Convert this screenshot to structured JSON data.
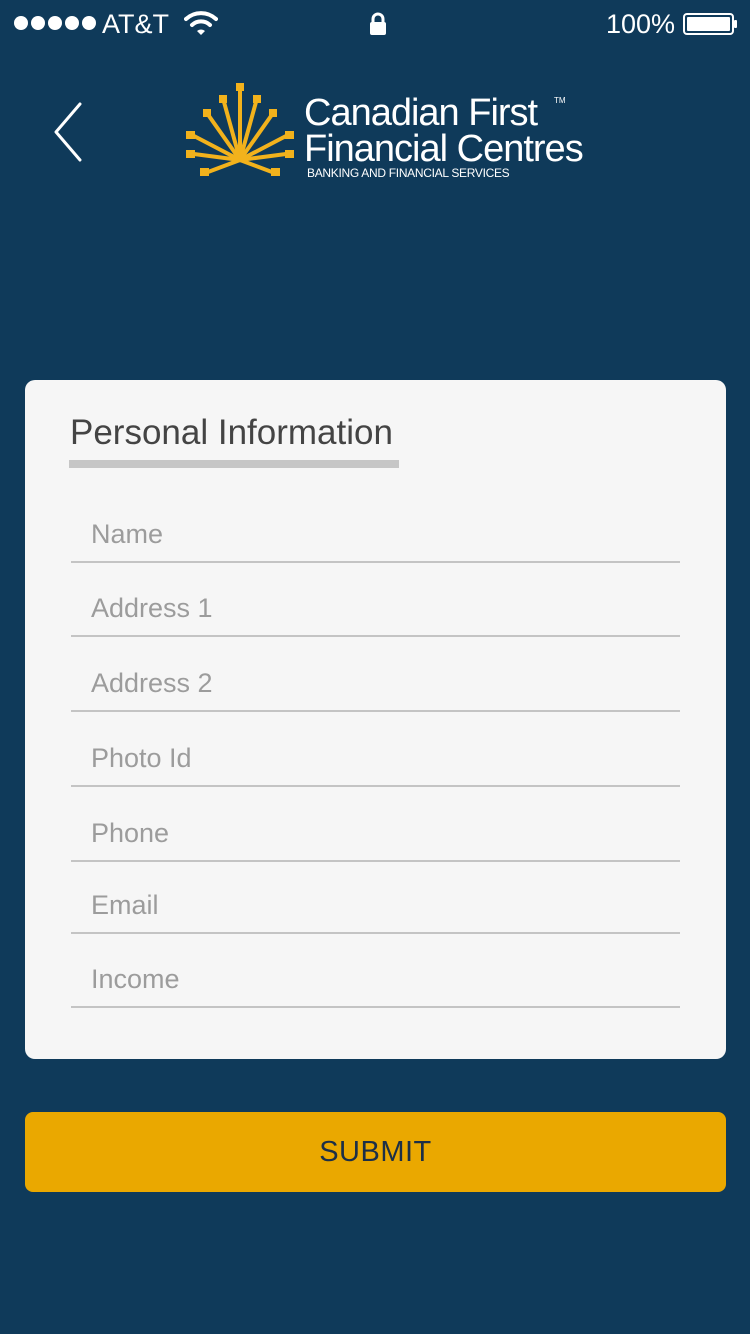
{
  "status_bar": {
    "carrier": "AT&T",
    "battery": "100%",
    "icons": [
      "signal-dots",
      "wifi-icon",
      "lock-icon",
      "battery-icon"
    ]
  },
  "header": {
    "back_icon": "chevron-left-icon",
    "logo": {
      "line1": "Canadian First",
      "line2": "Financial Centres",
      "tm": "TM",
      "tagline": "BANKING AND FINANCIAL SERVICES"
    }
  },
  "form": {
    "title": "Personal Information",
    "fields": [
      {
        "placeholder": "Name",
        "value": ""
      },
      {
        "placeholder": "Address 1",
        "value": ""
      },
      {
        "placeholder": "Address 2",
        "value": ""
      },
      {
        "placeholder": "Photo Id",
        "value": ""
      },
      {
        "placeholder": "Phone",
        "value": ""
      },
      {
        "placeholder": "Email",
        "value": ""
      },
      {
        "placeholder": "Income",
        "value": ""
      }
    ]
  },
  "submit_label": "SUBMIT",
  "colors": {
    "background": "#0f3a5a",
    "card": "#f6f6f6",
    "accent": "#eaa800",
    "logo_gold": "#f2b21c",
    "placeholder": "#9c9c9c"
  }
}
